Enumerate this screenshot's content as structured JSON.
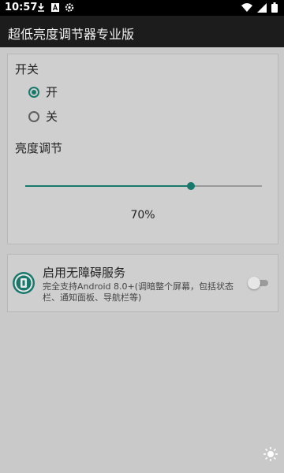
{
  "status_bar": {
    "time": "10:57",
    "icons": [
      "download-icon",
      "letter-a-icon",
      "gear-icon",
      "wifi-icon",
      "signal-icon",
      "battery-icon"
    ]
  },
  "app_bar": {
    "title": "超低亮度调节器专业版"
  },
  "switch_section": {
    "label": "开关",
    "options": [
      {
        "label": "开",
        "checked": true
      },
      {
        "label": "关",
        "checked": false
      }
    ]
  },
  "brightness_section": {
    "label": "亮度调节",
    "value_percent": 70,
    "value_text": "70%"
  },
  "service": {
    "title": "启用无障碍服务",
    "description": "完全支持Android 8.0+(调暗整个屏幕，包括状态栏、通知面板、导航栏等)",
    "enabled": false
  },
  "colors": {
    "accent": "#17786b",
    "app_bar": "#1c1c1c",
    "background": "#c9c9c9"
  }
}
